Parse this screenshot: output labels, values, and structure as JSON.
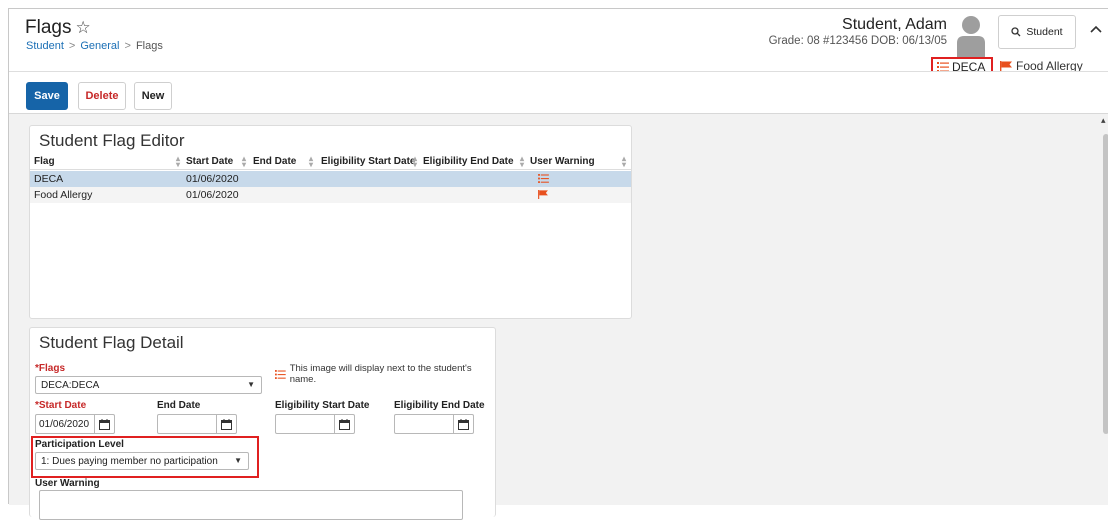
{
  "header": {
    "title": "Flags",
    "star_icon": "star-outline-icon",
    "breadcrumb": [
      "Student",
      "General",
      "Flags"
    ],
    "breadcrumb_sep": ">",
    "student_name": "Student, Adam",
    "student_meta": "Grade: 08 #123456 DOB: 06/13/05",
    "search_label": "Student",
    "search_icon": "search-icon",
    "collapse_icon": "chevron-up-icon",
    "flags": [
      {
        "label": "DECA",
        "icon": "list-icon",
        "color": "#e8501e"
      },
      {
        "label": "Food Allergy",
        "icon": "flag-icon",
        "color": "#e8501e"
      }
    ]
  },
  "toolbar": {
    "save_label": "Save",
    "delete_label": "Delete",
    "new_label": "New"
  },
  "editor": {
    "title": "Student Flag Editor",
    "columns": [
      "Flag",
      "Start Date",
      "End Date",
      "Eligibility Start Date",
      "Eligibility End Date",
      "User Warning"
    ],
    "rows": [
      {
        "flag": "DECA",
        "start": "01/06/2020",
        "end": "",
        "elig_start": "",
        "elig_end": "",
        "warning_icon": "list-icon",
        "selected": true
      },
      {
        "flag": "Food Allergy",
        "start": "01/06/2020",
        "end": "",
        "elig_start": "",
        "elig_end": "",
        "warning_icon": "flag-icon",
        "selected": false
      }
    ]
  },
  "detail": {
    "title": "Student Flag Detail",
    "flags_label": "*Flags",
    "flags_value": "DECA:DECA",
    "hint_text": "This image will display next to the student's name.",
    "start_date_label": "*Start Date",
    "start_date_value": "01/06/2020",
    "end_date_label": "End Date",
    "end_date_value": "",
    "elig_start_label": "Eligibility Start Date",
    "elig_start_value": "",
    "elig_end_label": "Eligibility End Date",
    "elig_end_value": "",
    "participation_label": "Participation Level",
    "participation_value": "1: Dues paying member no participation",
    "user_warning_label": "User Warning"
  },
  "colors": {
    "primary": "#1664a8",
    "danger": "#c62828",
    "flag_orange": "#e8501e",
    "highlight_outline": "#e02020",
    "selected_row": "#c7d9ea"
  }
}
